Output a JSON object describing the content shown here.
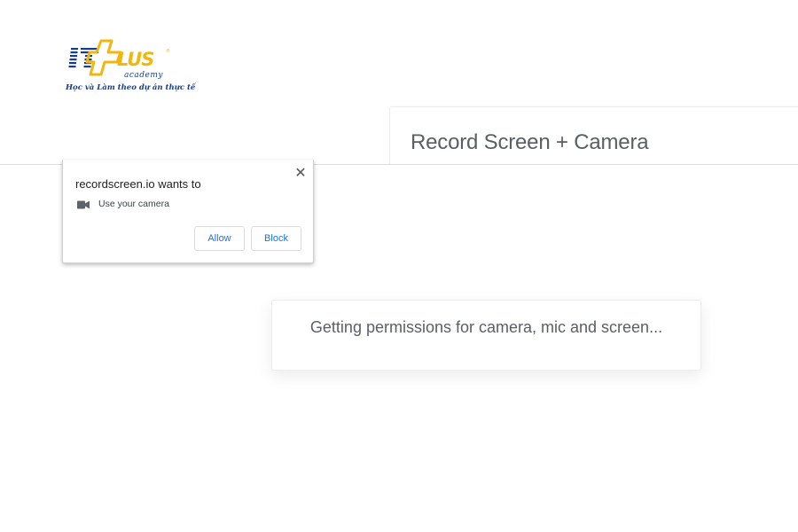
{
  "logo": {
    "subtitle": "academy",
    "tagline": "Học và Làm theo dự án thực tế"
  },
  "header": {
    "title": "Record Screen + Camera"
  },
  "permission_prompt": {
    "title": "recordscreen.io wants to",
    "close_label": "✕",
    "item_icon": "video-camera-icon",
    "item_label": "Use your camera",
    "allow_label": "Allow",
    "block_label": "Block"
  },
  "status": {
    "message": "Getting permissions for camera, mic and screen..."
  },
  "colors": {
    "accent": "#1a73e8",
    "logo_blue": "#1a3c8c",
    "logo_yellow": "#f2b70e"
  }
}
